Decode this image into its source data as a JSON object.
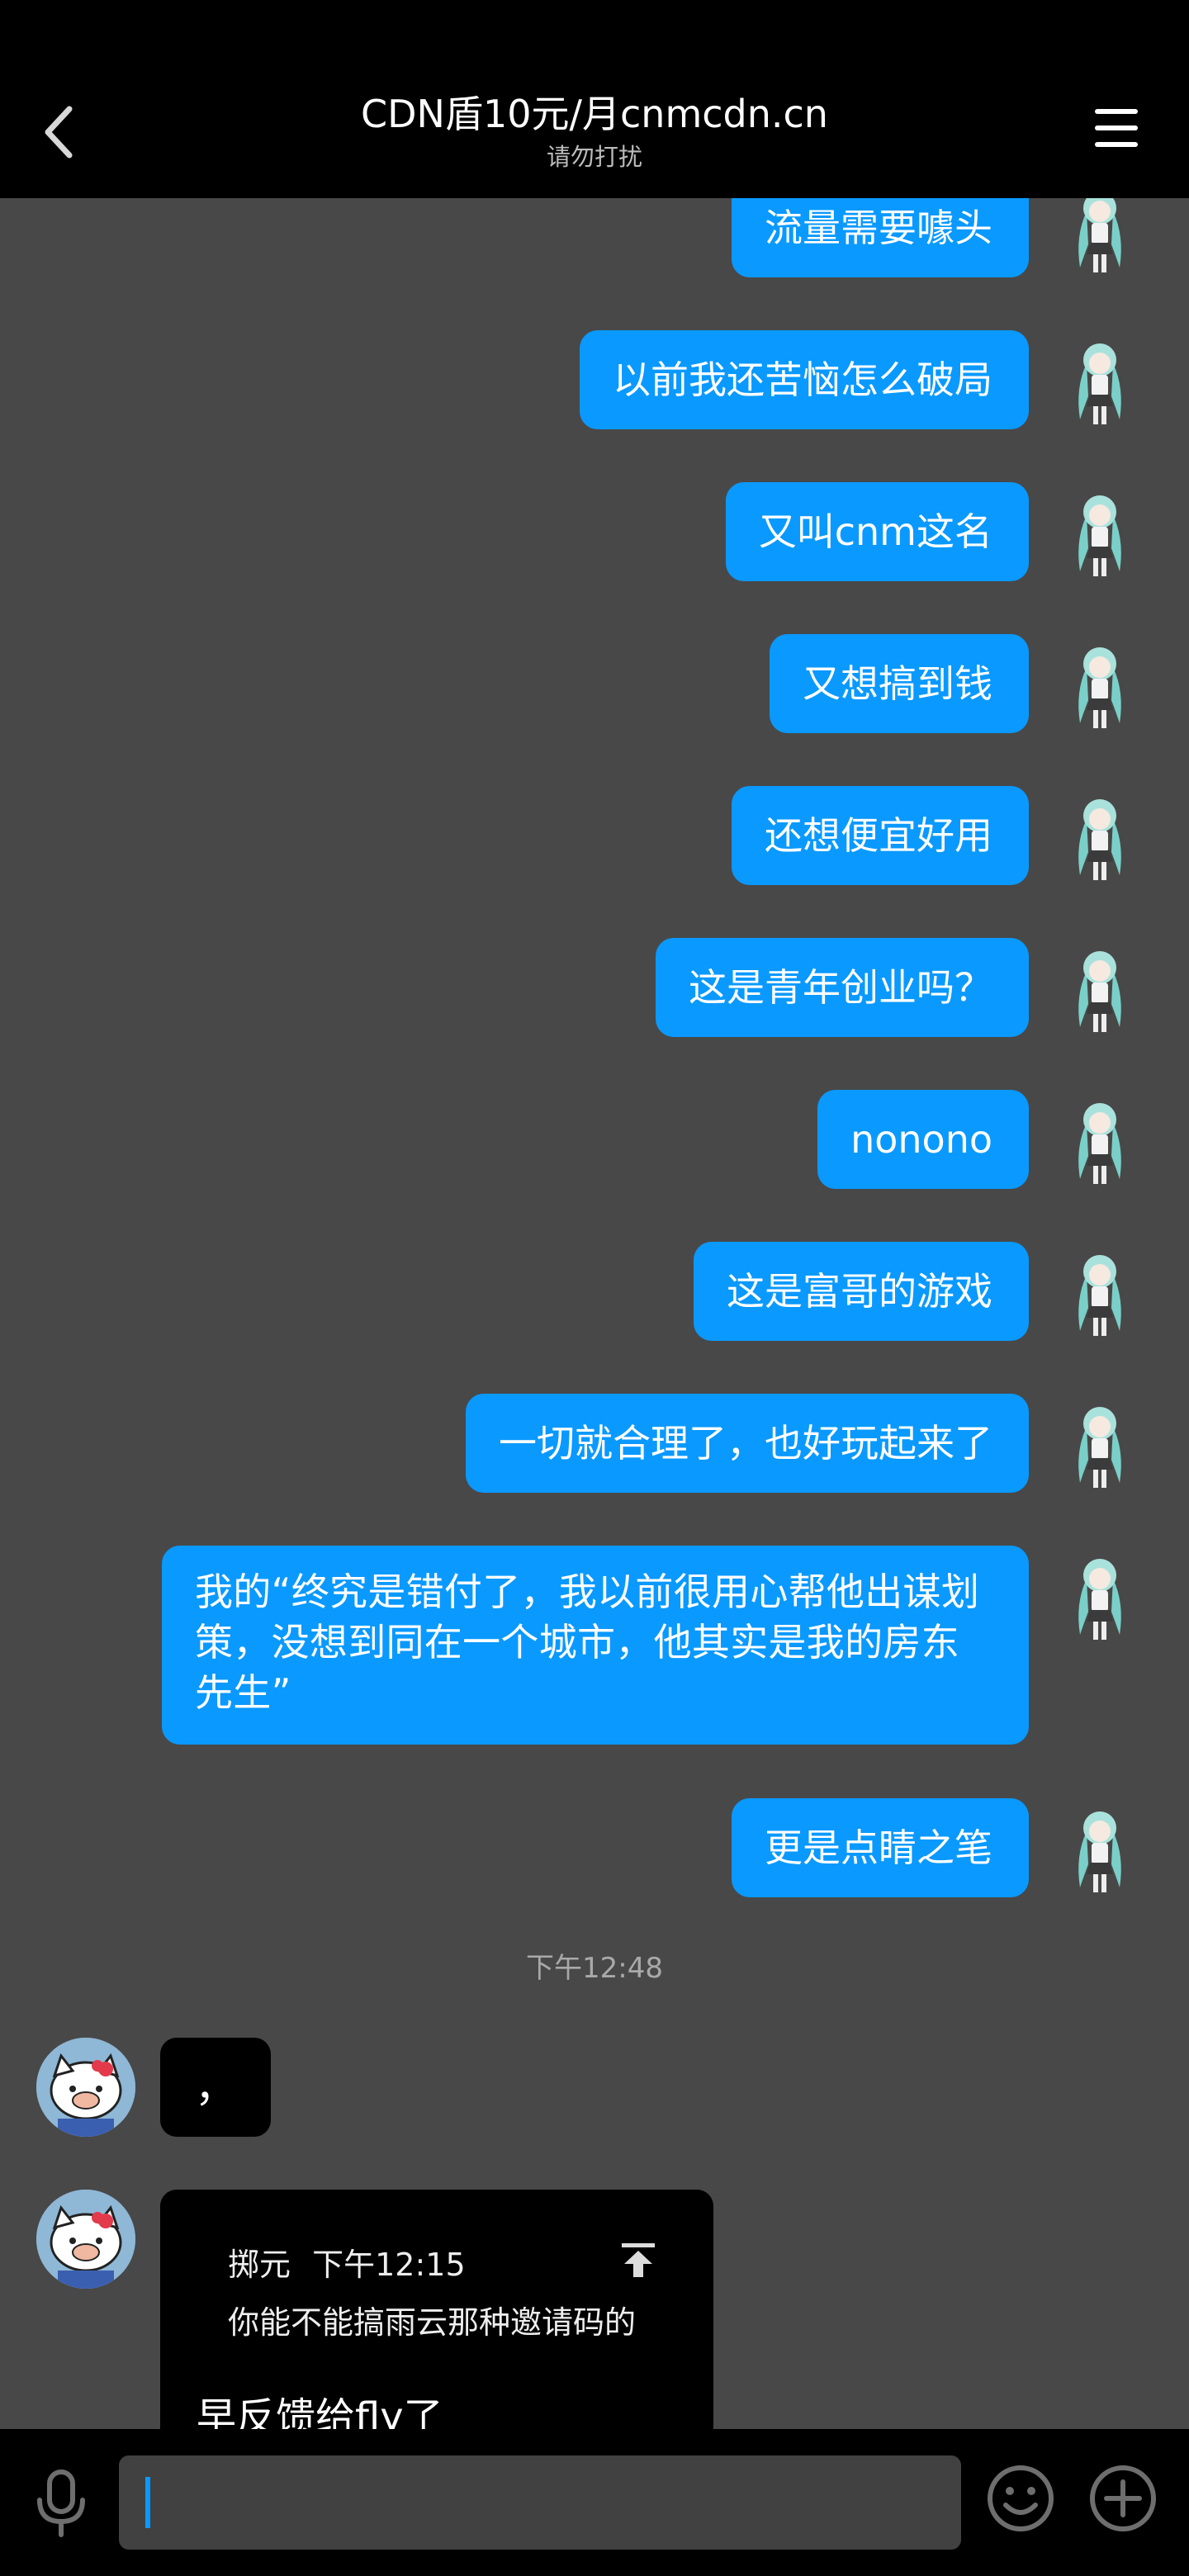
{
  "header": {
    "title": "CDN盾10元/月cnmcdn.cn",
    "subtitle": "请勿打扰"
  },
  "messages_out": [
    {
      "text": "流量需要噱头"
    },
    {
      "text": "以前我还苦恼怎么破局"
    },
    {
      "text": "又叫cnm这名"
    },
    {
      "text": "又想搞到钱"
    },
    {
      "text": "还想便宜好用"
    },
    {
      "text": "这是青年创业吗？"
    },
    {
      "text": "nonono"
    },
    {
      "text": "这是富哥的游戏"
    },
    {
      "text": "一切就合理了，也好玩起来了"
    },
    {
      "text": "我的“终究是错付了，我以前很用心帮他出谋划策，没想到同在一个城市，他其实是我的房东先生”"
    },
    {
      "text": "更是点睛之笔"
    }
  ],
  "timestamp": "下午12:48",
  "messages_in": [
    {
      "text": "，"
    }
  ],
  "quote_message": {
    "author": "掷元",
    "time": "下午12:15",
    "quoted_text": "你能不能搞雨云那种邀请码的",
    "reply_text": "早反馈给fly了"
  },
  "icons": {
    "back": "chevron-left-icon",
    "menu": "hamburger-menu-icon",
    "mic": "microphone-icon",
    "emoji": "smiley-icon",
    "plus": "plus-circle-icon",
    "quote_up": "scroll-to-top-icon"
  },
  "colors": {
    "outgoing_bubble": "#0a99ff",
    "incoming_bubble": "#000000",
    "chat_background": "#484848",
    "caret": "#0a99ff"
  }
}
